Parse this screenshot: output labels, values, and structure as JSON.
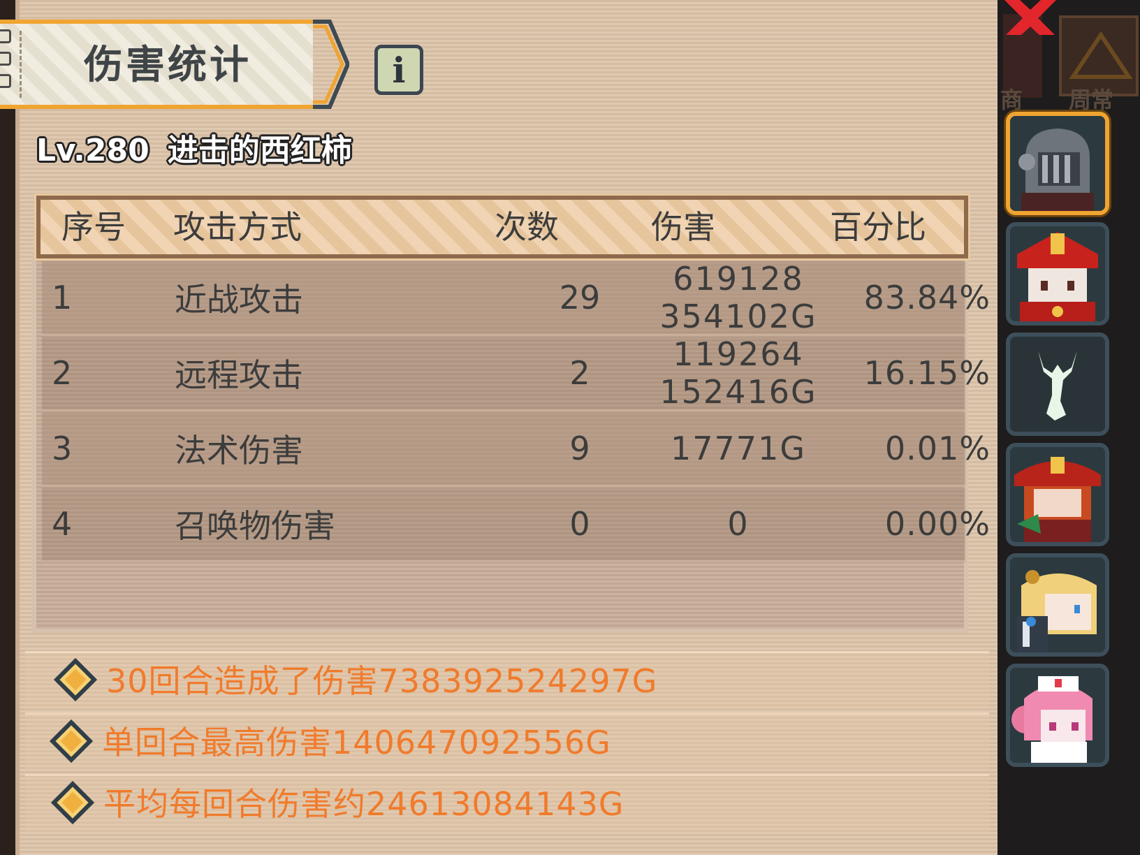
{
  "title": "伤害统计",
  "player": {
    "level": "Lv.280",
    "name": "进击的西红柿"
  },
  "table": {
    "headers": {
      "idx": "序号",
      "method": "攻击方式",
      "count": "次数",
      "damage": "伤害",
      "percent": "百分比"
    },
    "rows": [
      {
        "idx": "1",
        "method": "近战攻击",
        "count": "29",
        "damage": "619128\n354102G",
        "percent": "83.84%"
      },
      {
        "idx": "2",
        "method": "远程攻击",
        "count": "2",
        "damage": "119264\n152416G",
        "percent": "16.15%"
      },
      {
        "idx": "3",
        "method": "法术伤害",
        "count": "9",
        "damage": "17771G",
        "percent": "0.01%"
      },
      {
        "idx": "4",
        "method": "召唤物伤害",
        "count": "0",
        "damage": "0",
        "percent": "0.00%"
      }
    ]
  },
  "summary": [
    "30回合造成了伤害738392524297G",
    "单回合最高伤害140647092556G",
    "平均每回合伤害约24613084143G"
  ],
  "side_tabs": [
    "商",
    "周常"
  ],
  "portraits": [
    {
      "icon": "knight-helmet-portrait",
      "selected": true
    },
    {
      "icon": "red-hat-girl-portrait",
      "selected": false
    },
    {
      "icon": "white-stag-spirit-portrait",
      "selected": false
    },
    {
      "icon": "pirate-girl-portrait",
      "selected": false
    },
    {
      "icon": "blonde-mech-girl-portrait",
      "selected": false
    },
    {
      "icon": "pink-nurse-girl-portrait",
      "selected": false
    }
  ],
  "colors": {
    "accent": "#f0a431",
    "summary_text": "#f07b2c",
    "panel": "#dcc3a8",
    "header_border": "#8e6a4c"
  }
}
